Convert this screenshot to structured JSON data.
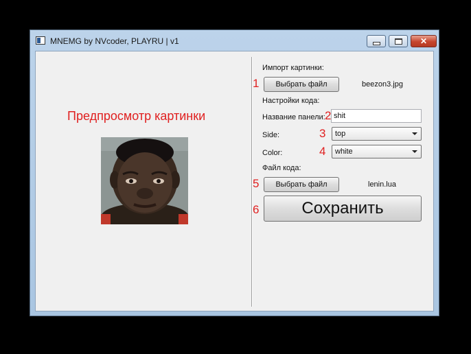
{
  "window": {
    "title": "MNEMG by NVcoder, PLAYRU | v1",
    "close_glyph": "✕"
  },
  "preview": {
    "title": "Предпросмотр картинки"
  },
  "import": {
    "heading": "Импорт картинки:",
    "button_label": "Выбрать файл",
    "file_name": "beezon3.jpg",
    "marker": "1"
  },
  "settings": {
    "heading": "Настройки кода:",
    "panel_name_label": "Название панели:",
    "panel_name_value": "shit",
    "panel_name_marker": "2",
    "side_label": "Side:",
    "side_value": "top",
    "side_marker": "3",
    "color_label": "Color:",
    "color_value": "white",
    "color_marker": "4"
  },
  "code_file": {
    "heading": "Файл кода:",
    "button_label": "Выбрать файл",
    "file_name": "lenin.lua",
    "marker": "5"
  },
  "save": {
    "button_label": "Сохранить",
    "marker": "6"
  },
  "colors": {
    "accent_red": "#e02020"
  }
}
